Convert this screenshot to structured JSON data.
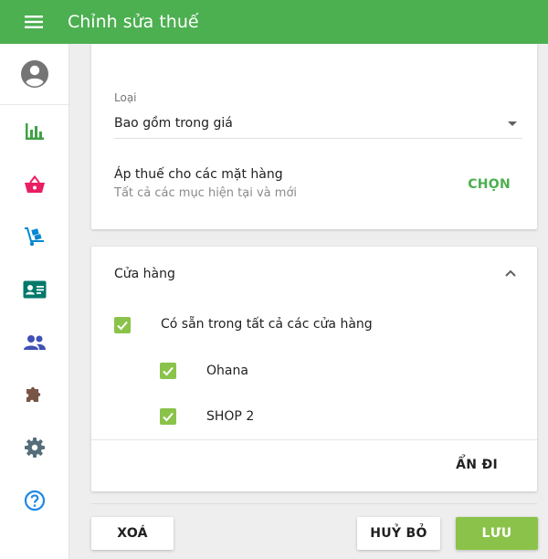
{
  "appbar": {
    "title": "Chỉnh sửa thuế"
  },
  "tax": {
    "type_label": "Loại",
    "type_value": "Bao gồm trong giá",
    "apply_title": "Áp thuế cho các mặt hàng",
    "apply_subtitle": "Tất cả các mục hiện tại và mới",
    "choose_label": "CHỌN"
  },
  "stores": {
    "title": "Cửa hàng",
    "all_label": "Có sẵn trong tất cả các cửa hàng",
    "items": [
      {
        "label": "Ohana",
        "checked": true
      },
      {
        "label": "SHOP 2",
        "checked": true
      }
    ],
    "hide_label": "ẨN ĐI"
  },
  "actions": {
    "delete_label": "XOÁ",
    "cancel_label": "HUỶ BỎ",
    "save_label": "LƯU"
  },
  "colors": {
    "primary": "#4caf50",
    "accent": "#8bc34a",
    "reports": "#43a047",
    "basket": "#e91e63",
    "items": "#0288d1",
    "customers": "#3f51b5",
    "integrations": "#795548",
    "settings": "#546e7a",
    "help": "#1e88e5"
  },
  "sidebar_icons": [
    "account-icon",
    "bar-chart-icon",
    "basket-icon",
    "dolly-icon",
    "id-card-icon",
    "people-icon",
    "puzzle-icon",
    "gear-icon",
    "help-icon"
  ]
}
